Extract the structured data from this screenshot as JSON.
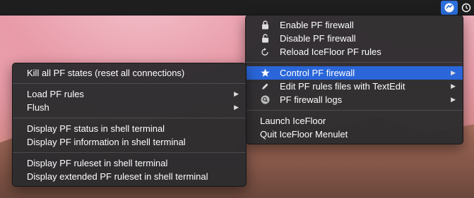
{
  "main_menu": {
    "items": [
      {
        "label": "Enable PF firewall",
        "icon": "lock-closed-icon"
      },
      {
        "label": "Disable PF firewall",
        "icon": "lock-open-icon"
      },
      {
        "label": "Reload IceFloor PF rules",
        "icon": "reload-icon"
      },
      {
        "label": "Control PF firewall",
        "icon": "star-icon"
      },
      {
        "label": "Edit PF rules files with TextEdit",
        "icon": "pencil-icon"
      },
      {
        "label": "PF firewall logs",
        "icon": "magnifier-icon"
      },
      {
        "label": "Launch IceFloor"
      },
      {
        "label": "Quit IceFloor Menulet"
      }
    ]
  },
  "submenu": {
    "items": [
      {
        "label": "Kill all PF states (reset all connections)"
      },
      {
        "label": "Load PF rules"
      },
      {
        "label": "Flush"
      },
      {
        "label": "Display PF status in shell terminal"
      },
      {
        "label": "Display PF information in shell terminal"
      },
      {
        "label": "Display PF ruleset in shell terminal"
      },
      {
        "label": "Display extended PF ruleset in shell terminal"
      }
    ]
  },
  "colors": {
    "highlight": "#2a66d9",
    "menu_bg": "#2c2c2e",
    "menubar": "#1e1e1e"
  }
}
